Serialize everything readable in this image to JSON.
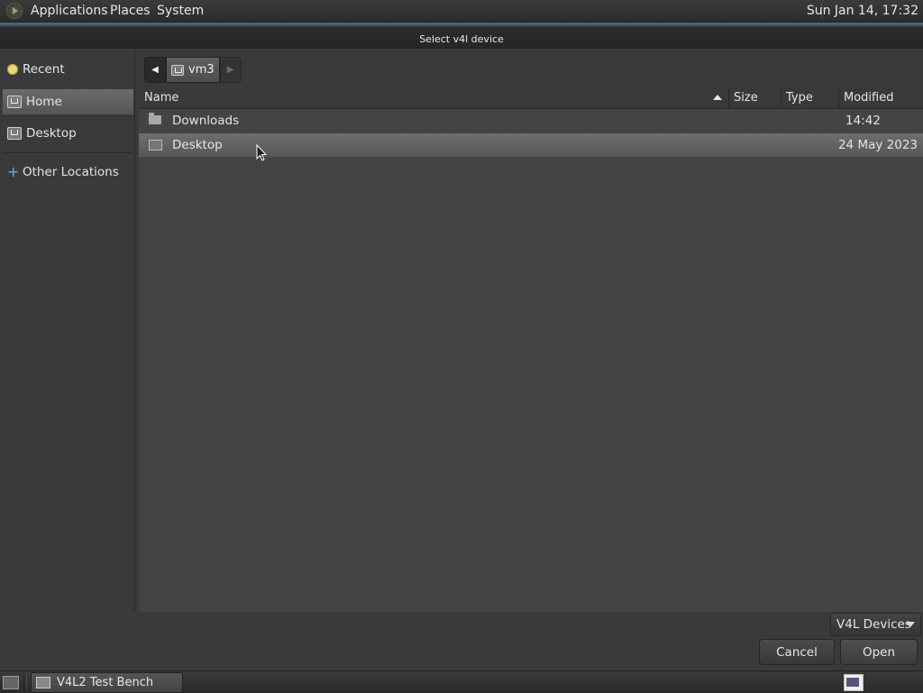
{
  "top_panel": {
    "menus": [
      "Applications",
      "Places",
      "System"
    ],
    "clock": "Sun Jan 14, 17:32"
  },
  "dialog": {
    "title": "Select v4l device",
    "sidebar": {
      "items": [
        {
          "label": "Recent",
          "icon": "clock-icon"
        },
        {
          "label": "Home",
          "icon": "home-folder-icon",
          "active": true
        },
        {
          "label": "Desktop",
          "icon": "desktop-folder-icon"
        },
        {
          "label": "Other Locations",
          "icon": "plus-icon"
        }
      ]
    },
    "pathbar": {
      "current": "vm3"
    },
    "columns": {
      "name": "Name",
      "size": "Size",
      "type": "Type",
      "modified": "Modified"
    },
    "files": [
      {
        "name": "Downloads",
        "size": "",
        "type": "",
        "modified": "14:42",
        "icon": "folder-icon",
        "selected": false
      },
      {
        "name": "Desktop",
        "size": "",
        "type": "",
        "modified": "24 May 2023",
        "icon": "desktop-folder-icon",
        "selected": true
      }
    ],
    "filter": "V4L Devices",
    "buttons": {
      "cancel": "Cancel",
      "open": "Open"
    }
  },
  "taskbar": {
    "task": "V4L2 Test Bench"
  }
}
